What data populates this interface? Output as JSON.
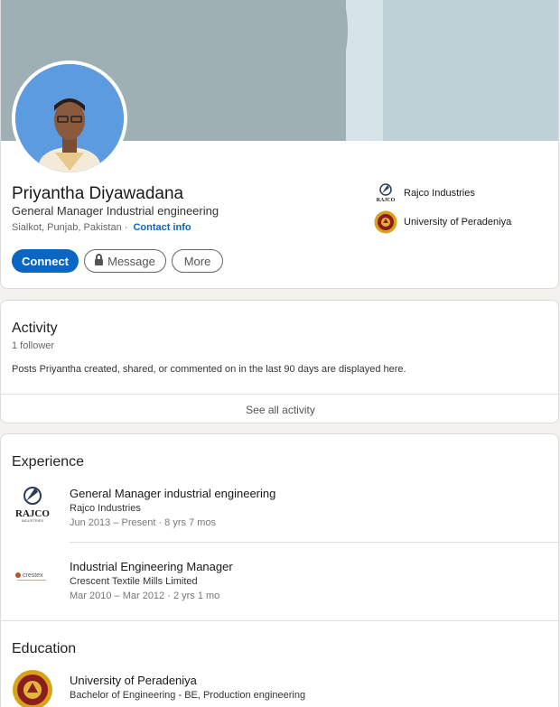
{
  "profile": {
    "name": "Priyantha Diyawadana",
    "headline": "General Manager Industrial engineering",
    "location": "Sialkot, Punjab, Pakistan",
    "separator": "·",
    "contact_info": "Contact info",
    "buttons": {
      "connect": "Connect",
      "message": "Message",
      "more": "More"
    },
    "side_orgs": [
      {
        "name": "Rajco Industries",
        "logo": "rajco-logo"
      },
      {
        "name": "University of Peradeniya",
        "logo": "peradeniya-crest"
      }
    ]
  },
  "activity": {
    "title": "Activity",
    "followers": "1 follower",
    "description": "Posts Priyantha created, shared, or commented on in the last 90 days are displayed here.",
    "see_all": "See all activity"
  },
  "experience": {
    "title": "Experience",
    "items": [
      {
        "title": "General Manager industrial engineering",
        "company": "Rajco Industries",
        "dates": "Jun 2013 – Present · 8 yrs 7 mos",
        "logo": "rajco-logo"
      },
      {
        "title": "Industrial Engineering Manager",
        "company": "Crescent Textile Mills Limited",
        "dates": "Mar 2010 – Mar 2012 · 2 yrs 1 mo",
        "logo": "crestex-logo"
      }
    ]
  },
  "education": {
    "title": "Education",
    "items": [
      {
        "school": "University of Peradeniya",
        "degree": "Bachelor of Engineering - BE, Production engineering",
        "logo": "peradeniya-crest"
      }
    ]
  },
  "logo_text": {
    "rajco": "RAJCO",
    "rajco_small": "INDUSTRIES",
    "crestex": "crestex"
  },
  "colors": {
    "accent": "#0a66c2",
    "banner": "#9fb0b4"
  }
}
